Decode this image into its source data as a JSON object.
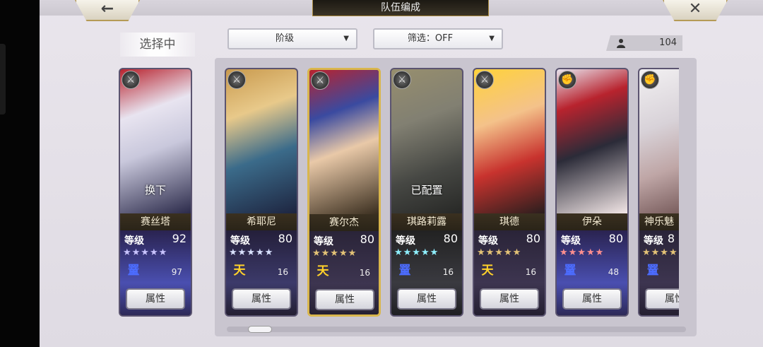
{
  "header": {
    "title": "队伍编成",
    "back_glyph": "←",
    "close_glyph": "✕"
  },
  "selecting_label": "选择中",
  "filters": {
    "sort": {
      "label": "阶级",
      "arrow": "▼"
    },
    "filter": {
      "label": "筛选：OFF",
      "arrow": "▼"
    }
  },
  "unit_count": "104",
  "colors": {
    "accent_gold": "#d9b64d",
    "panel": "#c9c5cf",
    "name_bar": "#3a3020"
  },
  "selected_unit": {
    "name": "赛丝塔",
    "overlay": "换下",
    "level_label": "等级",
    "level": "92",
    "stars": "★★★★★",
    "star_color": "#c9c4ff",
    "rank_glyph": "罿",
    "rank_color": "#4c6cff",
    "sub_value": "97",
    "attr_label": "属性",
    "weapon_icon": "sword-icon"
  },
  "cards": [
    {
      "name": "希耶尼",
      "overlay": "",
      "level_label": "等级",
      "level": "80",
      "stars": "★★★★★",
      "star_color": "#d9e2ff",
      "rank_glyph": "天",
      "rank_color": "#ffd12a",
      "sub_value": "16",
      "attr_label": "属性",
      "weapon_icon": "sword-icon",
      "selected": false
    },
    {
      "name": "赛尔杰",
      "overlay": "",
      "level_label": "等级",
      "level": "80",
      "stars": "★★★★★",
      "star_color": "#e3c276",
      "rank_glyph": "天",
      "rank_color": "#ffd12a",
      "sub_value": "16",
      "attr_label": "属性",
      "weapon_icon": "sword-icon",
      "selected": true
    },
    {
      "name": "琪路莉露",
      "overlay": "已配置",
      "level_label": "等级",
      "level": "80",
      "stars": "★★★★★",
      "star_color": "#8ff0ff",
      "rank_glyph": "罿",
      "rank_color": "#4c6cff",
      "sub_value": "16",
      "attr_label": "属性",
      "weapon_icon": "sword-icon",
      "selected": false
    },
    {
      "name": "琪德",
      "overlay": "",
      "level_label": "等级",
      "level": "80",
      "stars": "★★★★★",
      "star_color": "#e3c276",
      "rank_glyph": "天",
      "rank_color": "#ffd12a",
      "sub_value": "16",
      "attr_label": "属性",
      "weapon_icon": "sword-icon",
      "selected": false
    },
    {
      "name": "伊朵",
      "overlay": "",
      "level_label": "等级",
      "level": "80",
      "stars": "★★★★★",
      "star_color": "#ff8f8f",
      "rank_glyph": "罿",
      "rank_color": "#4c6cff",
      "sub_value": "48",
      "attr_label": "属性",
      "weapon_icon": "gauntlet-icon",
      "selected": false
    },
    {
      "name": "神乐魅",
      "overlay": "",
      "level_label": "等级",
      "level": "8",
      "stars": "★★★★",
      "star_color": "#e3c276",
      "rank_glyph": "罿",
      "rank_color": "#4c6cff",
      "sub_value": "",
      "attr_label": "属性",
      "weapon_icon": "gauntlet-icon",
      "selected": false
    }
  ]
}
